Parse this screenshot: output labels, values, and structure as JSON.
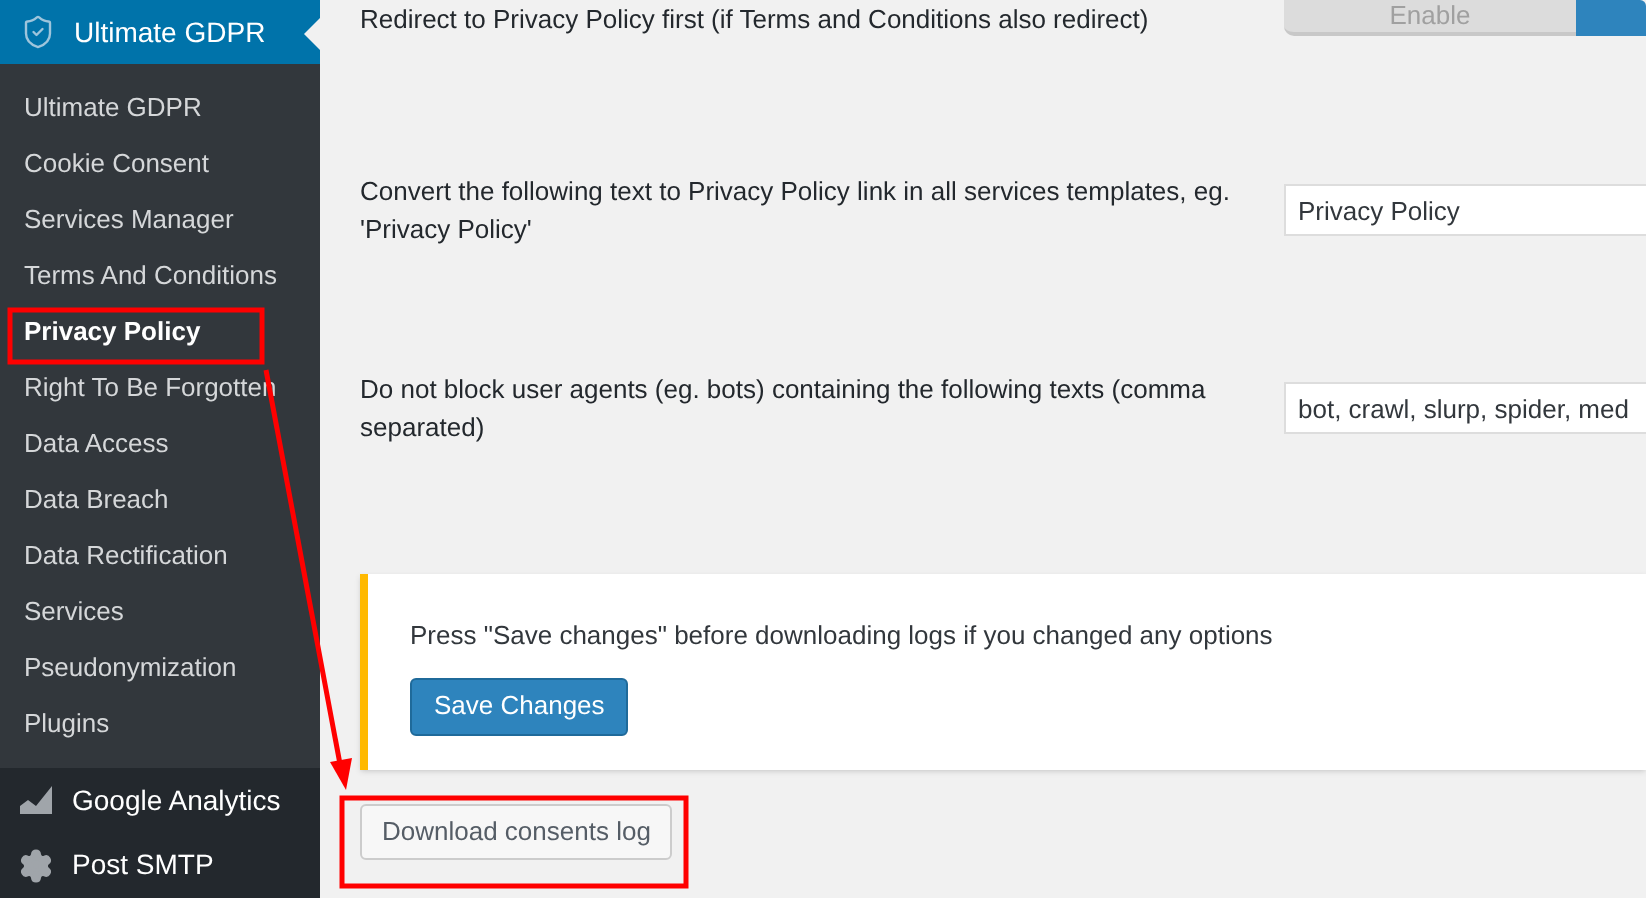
{
  "sidebar": {
    "header": {
      "label": "Ultimate GDPR",
      "selected": true
    },
    "items": [
      {
        "label": "Ultimate GDPR",
        "selected": false
      },
      {
        "label": "Cookie Consent",
        "selected": false
      },
      {
        "label": "Services Manager",
        "selected": false
      },
      {
        "label": "Terms And Conditions",
        "selected": false
      },
      {
        "label": "Privacy Policy",
        "selected": true
      },
      {
        "label": "Right To Be Forgotten",
        "selected": false
      },
      {
        "label": "Data Access",
        "selected": false
      },
      {
        "label": "Data Breach",
        "selected": false
      },
      {
        "label": "Data Rectification",
        "selected": false
      },
      {
        "label": "Services",
        "selected": false
      },
      {
        "label": "Pseudonymization",
        "selected": false
      },
      {
        "label": "Plugins",
        "selected": false
      }
    ],
    "menu": [
      {
        "label": "Google Analytics",
        "kind": "chart"
      },
      {
        "label": "Post SMTP",
        "kind": "gear"
      }
    ]
  },
  "settings": [
    {
      "kind": "toggle",
      "label": "Redirect to Privacy Policy first (if Terms and Conditions also redirect)",
      "options": [
        {
          "label": "Enable",
          "selected": false
        },
        {
          "selected": true
        }
      ]
    },
    {
      "kind": "text",
      "label": "Convert the following text to Privacy Policy link in all services templates, eg. 'Privacy Policy'",
      "value": "Privacy Policy"
    },
    {
      "kind": "text",
      "label": "Do not block user agents (eg. bots) containing the following texts (comma separated)",
      "value": "bot, crawl, slurp, spider, med"
    }
  ],
  "notice": {
    "text": "Press \"Save changes\" before downloading logs if you changed any options",
    "button": "Save Changes"
  },
  "download_button": "Download consents log"
}
